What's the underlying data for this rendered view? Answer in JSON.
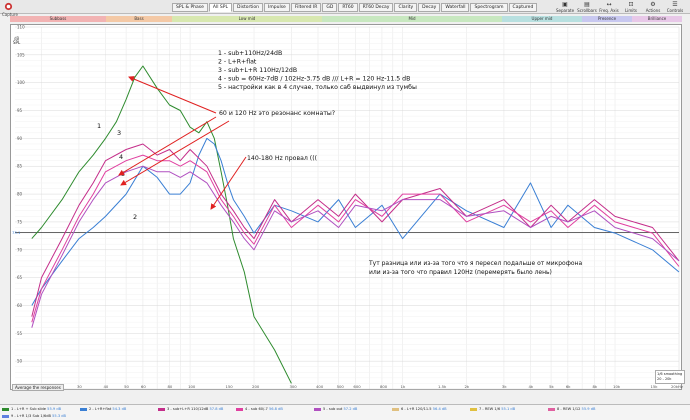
{
  "app": {
    "label": "Capture"
  },
  "tabs": [
    "SPL & Phase",
    "All SPL",
    "Distortion",
    "Impulse",
    "Filtered IR",
    "GD",
    "RT60",
    "RT60 Decay",
    "Clarity",
    "Decay",
    "Waterfall",
    "Spectrogram",
    "Captured"
  ],
  "active_tab": 1,
  "right_tools": [
    {
      "icon": "separate-icon",
      "label": "Separate"
    },
    {
      "icon": "scroll-bars-icon",
      "label": "Scrollbars"
    },
    {
      "icon": "freq-axis-icon",
      "label": "Freq. Axis"
    },
    {
      "icon": "limits-icon",
      "label": "Limits"
    },
    {
      "icon": "actions-icon",
      "label": "Actions"
    },
    {
      "icon": "controls-icon",
      "label": "Controls"
    }
  ],
  "bands": [
    {
      "label": "Subbass",
      "color": "#f2b3b3"
    },
    {
      "label": "Bass",
      "color": "#f4c9a6"
    },
    {
      "label": "Low mid",
      "color": "#d8e8b0"
    },
    {
      "label": "Mid",
      "color": "#c8e8c0"
    },
    {
      "label": "Upper mid",
      "color": "#b8e0e0"
    },
    {
      "label": "Presence",
      "color": "#c8c8f0"
    },
    {
      "label": "Brilliance",
      "color": "#e8c8e8"
    }
  ],
  "y_unit": "SPL",
  "y_db": "dB",
  "annotations": {
    "list": [
      "1 - sub+110Hz/24dB",
      "2 - L+R+flat",
      "3 - sub+L+R 110Hz/12dB",
      "4 - sub = 60Hz-7dB / 102Hz-3.75 dB /// L+R = 120 Hz-11.5 dB",
      "5 - настройки как в 4 случае, только саб выдвинул из тумбы"
    ],
    "resonance": "60 и 120 Hz это резонанс комнаты?",
    "dip": "140-180 Hz провал (((",
    "diff1": "Тут разница или из-за того что я пересел подальше от микрофона",
    "diff2": "или из-за того что правил 120Hz (перемерять было лень)",
    "curve_labels": [
      "1",
      "2",
      "3",
      "4",
      "5"
    ]
  },
  "controls": {
    "average_button": "Average the responses",
    "zoom": [
      "1/6 smoothing",
      "20 - 20k"
    ]
  },
  "chart_data": {
    "type": "line",
    "title": "",
    "xlabel": "",
    "ylabel": "SPL",
    "x_scale": "log",
    "xlim": [
      15,
      20000
    ],
    "ylim": [
      45,
      110
    ],
    "x_ticks": [
      "15",
      "20",
      "30",
      "40",
      "50",
      "60",
      "80",
      "100",
      "150",
      "200",
      "300",
      "400",
      "500",
      "600",
      "800",
      "1k",
      "1.5k",
      "2k",
      "3k",
      "4k",
      "5k",
      "6k",
      "8k",
      "10k",
      "15k",
      "20kHz"
    ],
    "y_ticks": [
      110,
      105,
      100,
      95,
      90,
      85,
      80,
      75,
      70,
      65,
      60,
      55,
      50,
      45
    ],
    "ref_level": 73.1,
    "series": [
      {
        "name": "1",
        "color": "#2e8b2e",
        "x": [
          18,
          20,
          25,
          30,
          35,
          40,
          45,
          50,
          55,
          60,
          70,
          80,
          90,
          100,
          110,
          120,
          130,
          140,
          150,
          160,
          180,
          200,
          250,
          300
        ],
        "y": [
          72,
          74,
          79,
          84,
          87,
          90,
          93,
          97,
          101,
          103,
          99,
          96,
          95,
          92,
          91,
          93,
          90,
          84,
          78,
          72,
          66,
          58,
          52,
          46
        ]
      },
      {
        "name": "2",
        "color": "#3a7fd4",
        "x": [
          18,
          20,
          25,
          30,
          35,
          40,
          50,
          60,
          70,
          80,
          90,
          100,
          110,
          120,
          130,
          140,
          150,
          160,
          180,
          200,
          250,
          300,
          400,
          500,
          600,
          800,
          1000,
          1500,
          2000,
          3000,
          4000,
          5000,
          6000,
          8000,
          10000,
          15000,
          20000
        ],
        "y": [
          60,
          63,
          68,
          72,
          74,
          76,
          80,
          85,
          83,
          80,
          80,
          82,
          87,
          90,
          89,
          86,
          82,
          79,
          76,
          73,
          78,
          77,
          75,
          79,
          74,
          78,
          72,
          80,
          77,
          74,
          82,
          74,
          78,
          74,
          73,
          70,
          66
        ]
      },
      {
        "name": "3",
        "color": "#c42e8a",
        "x": [
          18,
          20,
          25,
          30,
          35,
          40,
          50,
          60,
          70,
          80,
          90,
          100,
          120,
          140,
          160,
          180,
          200,
          250,
          300,
          400,
          500,
          600,
          800,
          1000,
          1500,
          2000,
          3000,
          4000,
          5000,
          6000,
          8000,
          10000,
          15000,
          20000
        ],
        "y": [
          58,
          65,
          72,
          78,
          82,
          86,
          88,
          89,
          87,
          88,
          86,
          88,
          85,
          80,
          77,
          74,
          72,
          79,
          75,
          79,
          76,
          80,
          75,
          79,
          81,
          76,
          79,
          74,
          78,
          75,
          79,
          76,
          74,
          68
        ]
      },
      {
        "name": "4",
        "color": "#e040a0",
        "x": [
          18,
          20,
          25,
          30,
          35,
          40,
          50,
          60,
          70,
          80,
          90,
          100,
          120,
          140,
          160,
          180,
          200,
          250,
          300,
          400,
          500,
          600,
          800,
          1000,
          1500,
          2000,
          3000,
          4000,
          5000,
          6000,
          8000,
          10000,
          15000,
          20000
        ],
        "y": [
          57,
          63,
          70,
          76,
          80,
          84,
          86,
          87,
          86,
          86,
          85,
          86,
          84,
          79,
          76,
          73,
          71,
          78,
          74,
          78,
          75,
          79,
          76,
          80,
          80,
          75,
          78,
          75,
          77,
          74,
          78,
          75,
          73,
          67
        ]
      },
      {
        "name": "5",
        "color": "#b050c0",
        "x": [
          18,
          20,
          25,
          30,
          35,
          40,
          50,
          60,
          70,
          80,
          90,
          100,
          120,
          140,
          160,
          180,
          200,
          250,
          300,
          400,
          500,
          600,
          800,
          1000,
          1500,
          2000,
          3000,
          4000,
          5000,
          6000,
          8000,
          10000,
          15000,
          20000
        ],
        "y": [
          56,
          62,
          69,
          75,
          79,
          82,
          84,
          85,
          84,
          84,
          83,
          84,
          82,
          78,
          75,
          72,
          70,
          77,
          75,
          77,
          74,
          78,
          77,
          79,
          79,
          76,
          77,
          74,
          76,
          75,
          77,
          74,
          72,
          68
        ]
      }
    ]
  },
  "legend_rows": [
    [
      {
        "label": "1 - L+R + Sub slide",
        "value": "55.9 dB",
        "color": "#2e8b2e"
      },
      {
        "label": "2 - L+R+flat",
        "value": "54.3 dB",
        "color": "#3a7fd4"
      },
      {
        "label": "3 - sub+L+R 110/12dB",
        "value": "57.8 dB",
        "color": "#c42e8a"
      },
      {
        "label": "4 - sub 60/-7",
        "value": "56.8 dB",
        "color": "#e040a0"
      },
      {
        "label": "5 - sub out",
        "value": "57.2 dB",
        "color": "#b050c0"
      },
      {
        "label": "6 - L+R 120/11.5",
        "value": "56.4 dB",
        "color": "#e0c080"
      },
      {
        "label": "7 - REW 1/6",
        "value": "55.1 dB",
        "color": "#e0c040"
      },
      {
        "label": "8 - REW 1/12",
        "value": "55.9 dB",
        "color": "#e060a0"
      }
    ],
    [
      {
        "label": "9 - L+R 1/3 Sub 1/6dB",
        "value": "55.3 dB",
        "color": "#6080e0"
      }
    ]
  ]
}
